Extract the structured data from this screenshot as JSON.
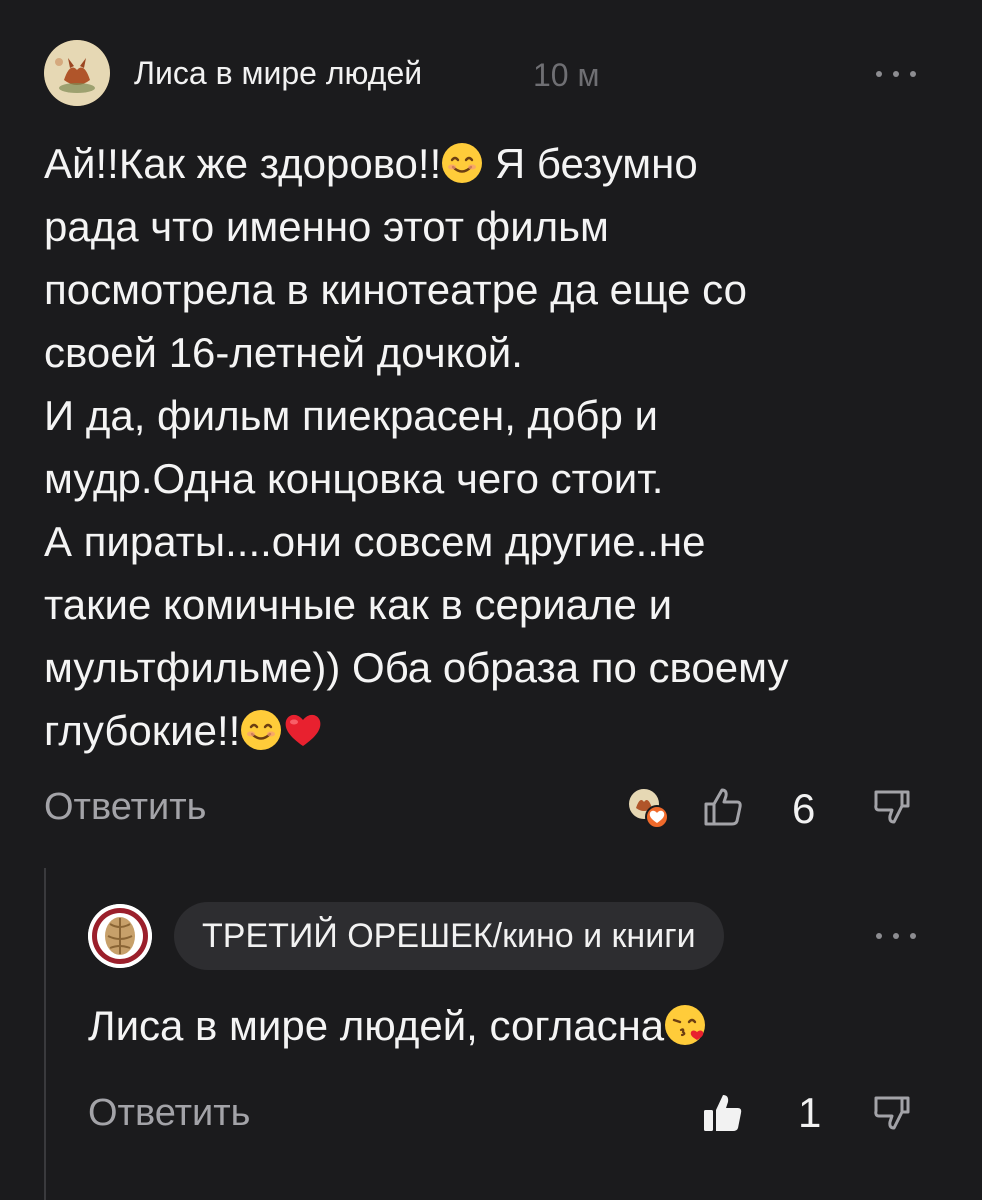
{
  "comment": {
    "author": "Лиса в мире людей",
    "time": "10 м",
    "lines": [
      "Ай!!Как же здорово!!",
      " Я безумно",
      "рада что именно этот фильм",
      "посмотрела в кинотеатре да еще со",
      "своей 16-летней дочкой.",
      "И да, фильм пиекрасен, добр и",
      "мудр.Одна концовка чего стоит.",
      "А пираты....они совсем другие..не",
      "такие комичные как в сериале и",
      "мультфильме)) Оба образа по своему",
      "глубокие!!"
    ],
    "reply_label": "Ответить",
    "likes": "6",
    "icons": {
      "avatar": "fox-avatar",
      "reacted_avatar": "reacted-user-avatar-heart-icon",
      "like": "thumb-up-outline-icon",
      "dislike": "thumb-down-outline-icon",
      "more": "more-dots-icon",
      "emoji_smile": "smiling-face-icon",
      "emoji_heart": "red-heart-icon"
    }
  },
  "reply": {
    "author": "ТРЕТИЙ ОРЕШЕК/кино и книги",
    "text": "Лиса в мире людей, согласна",
    "reply_label": "Ответить",
    "likes": "1",
    "icons": {
      "avatar": "walnut-avatar",
      "like": "thumb-up-filled-icon",
      "dislike": "thumb-down-outline-icon",
      "more": "more-dots-icon",
      "emoji_kiss": "face-blowing-kiss-icon"
    }
  },
  "colors": {
    "background": "#1b1b1d",
    "text": "#f2f2f2",
    "muted": "#a3a3a8",
    "chip": "#2d2d30",
    "heart": "#e8212f",
    "emoji_yellow": "#ffcc3a"
  }
}
